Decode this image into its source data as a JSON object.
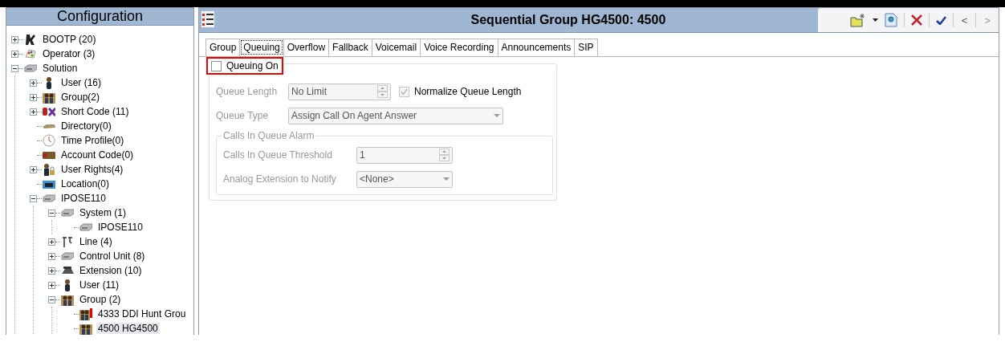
{
  "sidebar": {
    "title": "Configuration",
    "tree": [
      {
        "label": "BOOTP (20)",
        "kind": "tool",
        "expanded": false,
        "selected": false
      },
      {
        "label": "Operator (3)",
        "kind": "palette",
        "expanded": false,
        "selected": false
      },
      {
        "label": "Solution",
        "kind": "device",
        "expanded": true,
        "selected": false,
        "children": [
          {
            "label": "User (16)",
            "kind": "person",
            "expanded": false,
            "selected": false
          },
          {
            "label": "Group(2)",
            "kind": "group",
            "expanded": false,
            "selected": false
          },
          {
            "label": "Short Code (11)",
            "kind": "code",
            "expanded": false,
            "selected": false
          },
          {
            "label": "Directory(0)",
            "kind": "book",
            "selected": false
          },
          {
            "label": "Time Profile(0)",
            "kind": "clock",
            "selected": false
          },
          {
            "label": "Account Code(0)",
            "kind": "card",
            "selected": false
          },
          {
            "label": "User Rights(4)",
            "kind": "lock",
            "expanded": false,
            "selected": false
          },
          {
            "label": "Location(0)",
            "kind": "location",
            "selected": false
          },
          {
            "label": "IPOSE110",
            "kind": "device",
            "expanded": true,
            "selected": false,
            "children": [
              {
                "label": "System (1)",
                "kind": "device",
                "expanded": true,
                "selected": false,
                "children": [
                  {
                    "label": "IPOSE110",
                    "kind": "device",
                    "selected": false
                  }
                ]
              },
              {
                "label": "Line (4)",
                "kind": "line",
                "expanded": false,
                "selected": false
              },
              {
                "label": "Control Unit (8)",
                "kind": "device",
                "expanded": false,
                "selected": false
              },
              {
                "label": "Extension (10)",
                "kind": "phone",
                "expanded": false,
                "selected": false
              },
              {
                "label": "User (11)",
                "kind": "person",
                "expanded": false,
                "selected": false
              },
              {
                "label": "Group (2)",
                "kind": "group",
                "expanded": true,
                "selected": false,
                "children": [
                  {
                    "label": "4333 DDI Hunt Grou",
                    "kind": "group-flag",
                    "selected": false
                  },
                  {
                    "label": "4500 HG4500",
                    "kind": "group",
                    "selected": true
                  }
                ]
              }
            ]
          }
        ]
      }
    ]
  },
  "panel": {
    "title": "Sequential Group HG4500: 4500",
    "toolbar": [
      {
        "kind": "new"
      },
      {
        "kind": "caret"
      },
      {
        "kind": "export"
      },
      {
        "kind": "sep"
      },
      {
        "kind": "cancel"
      },
      {
        "kind": "sep"
      },
      {
        "kind": "ok"
      },
      {
        "kind": "sep"
      },
      {
        "kind": "prev",
        "label": "<"
      },
      {
        "kind": "sep"
      },
      {
        "kind": "next",
        "label": ">"
      }
    ],
    "tabs": [
      {
        "label": "Group",
        "selected": false
      },
      {
        "label": "Queuing",
        "selected": true
      },
      {
        "label": "Overflow",
        "selected": false
      },
      {
        "label": "Fallback",
        "selected": false
      },
      {
        "label": "Voicemail",
        "selected": false
      },
      {
        "label": "Voice Recording",
        "selected": false
      },
      {
        "label": "Announcements",
        "selected": false
      },
      {
        "label": "SIP",
        "selected": false
      }
    ],
    "queuing_on": {
      "label": "Queuing On",
      "checked": false,
      "highlighted": true
    },
    "queue_length": {
      "label": "Queue Length",
      "value": "No Limit",
      "disabled": true
    },
    "normalize": {
      "label": "Normalize Queue Length",
      "checked": true,
      "disabled": true
    },
    "queue_type": {
      "label": "Queue Type",
      "value": "Assign Call On Agent Answer",
      "disabled": true
    },
    "alarm": {
      "title": "Calls In Queue Alarm",
      "threshold": {
        "label": "Calls In Queue Threshold",
        "value": "1",
        "disabled": true
      },
      "extension": {
        "label": "Analog Extension to Notify",
        "value": "<None>",
        "disabled": true
      }
    }
  }
}
